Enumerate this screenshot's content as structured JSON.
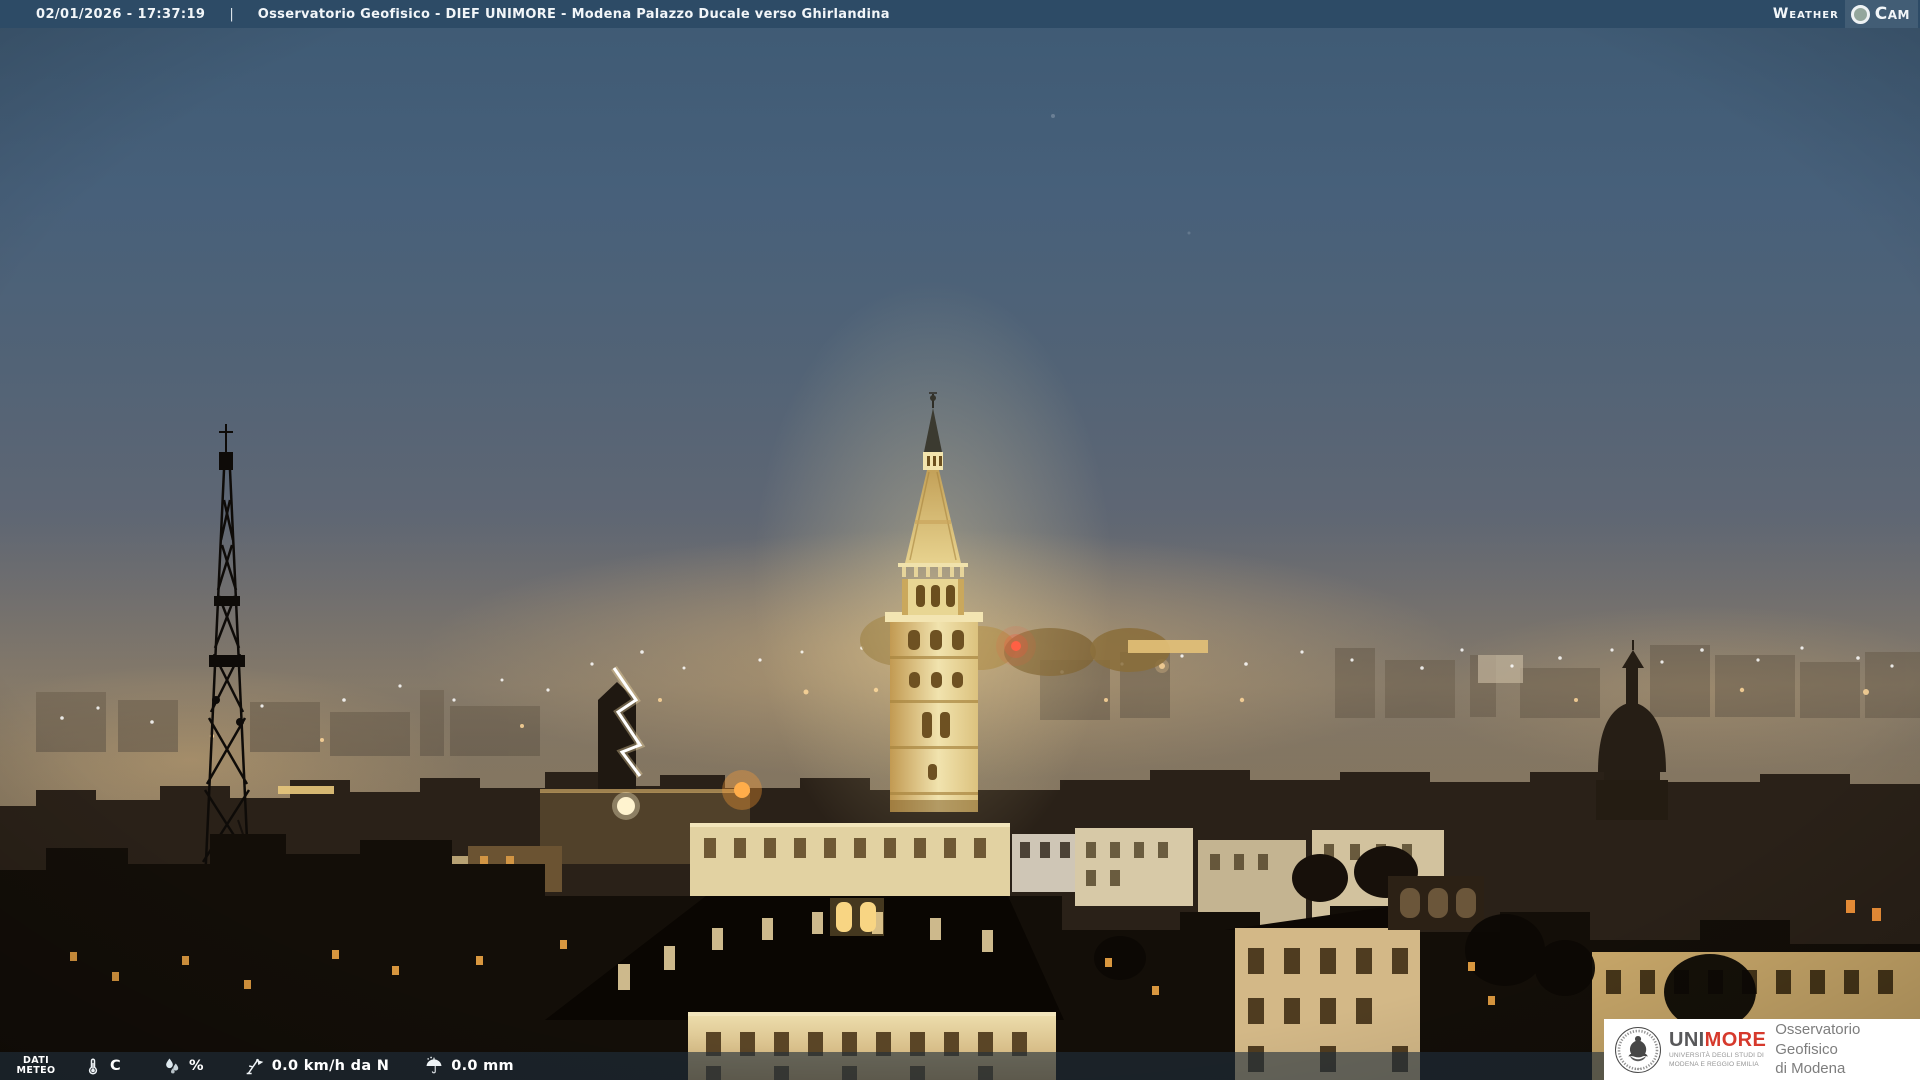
{
  "header": {
    "datetime": "02/01/2026 - 17:37:19",
    "separator": "|",
    "title": "Osservatorio Geofisico - DIEF UNIMORE - Modena Palazzo Ducale verso Ghirlandina",
    "weathercam": {
      "weather": "Weather",
      "cam": "Cam",
      "lens_icon": "camera-lens-icon"
    }
  },
  "footer": {
    "label_line1": "DATI",
    "label_line2": "METEO",
    "temperature": {
      "icon": "thermometer-icon",
      "value": "C"
    },
    "humidity": {
      "icon": "humidity-drops-icon",
      "value": "%"
    },
    "wind": {
      "icon": "wind-vane-icon",
      "value": "0.0 km/h da N"
    },
    "rain": {
      "icon": "umbrella-icon",
      "value": "0.0 mm"
    }
  },
  "logo_box": {
    "seal_icon": "unimore-seal-icon",
    "brand_uni": "UNI",
    "brand_more": "MORE",
    "university_line1": "UNIVERSITÀ DEGLI STUDI DI",
    "university_line2": "MODENA E REGGIO EMILIA",
    "observatory_line1": "Osservatorio Geofisico",
    "observatory_line2": "di Modena"
  },
  "colors": {
    "top_bar": "#2d4b66",
    "bottom_bar": "rgba(33,47,60,0.62)",
    "brand_red": "#d6392c",
    "logo_background": "#ffffff",
    "overlay_text": "#ffffff",
    "tower_light": "#f1e3ae"
  }
}
